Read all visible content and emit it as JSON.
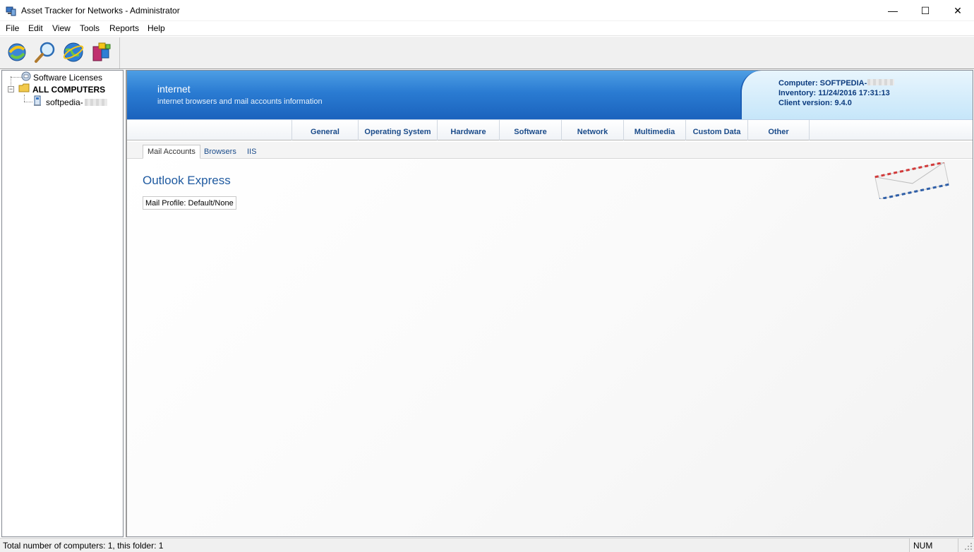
{
  "window": {
    "title": "Asset Tracker for Networks - Administrator",
    "minimize_glyph": "—",
    "maximize_glyph": "☐",
    "close_glyph": "✕"
  },
  "menu": [
    "File",
    "Edit",
    "View",
    "Tools",
    "Reports",
    "Help"
  ],
  "toolbar": {
    "buttons": [
      "refresh-icon",
      "search-icon",
      "internet-icon",
      "packages-icon"
    ]
  },
  "tree": {
    "software_licenses": "Software Licenses",
    "all_computers": "ALL COMPUTERS",
    "computer": "softpedia-",
    "expander_glyph": "−"
  },
  "banner": {
    "title": "internet",
    "subtitle": "internet browsers and mail accounts information",
    "computer": "Computer: SOFTPEDIA-",
    "inventory": "Inventory: 11/24/2016 17:31:13",
    "client_version": "Client version: 9.4.0"
  },
  "tabs": [
    "General",
    "Operating System",
    "Hardware",
    "Software",
    "Network",
    "Multimedia",
    "Custom Data",
    "Other"
  ],
  "subtabs": {
    "mail_accounts": "Mail Accounts",
    "browsers": "Browsers",
    "iis": "IIS"
  },
  "section": {
    "title": "Outlook Express",
    "mail_profile": "Mail Profile: Default/None"
  },
  "status": {
    "text": "Total number of computers: 1, this folder: 1",
    "num": "NUM"
  },
  "colors": {
    "banner_blue": "#2a7bd2",
    "link_blue": "#1a4b8a"
  }
}
